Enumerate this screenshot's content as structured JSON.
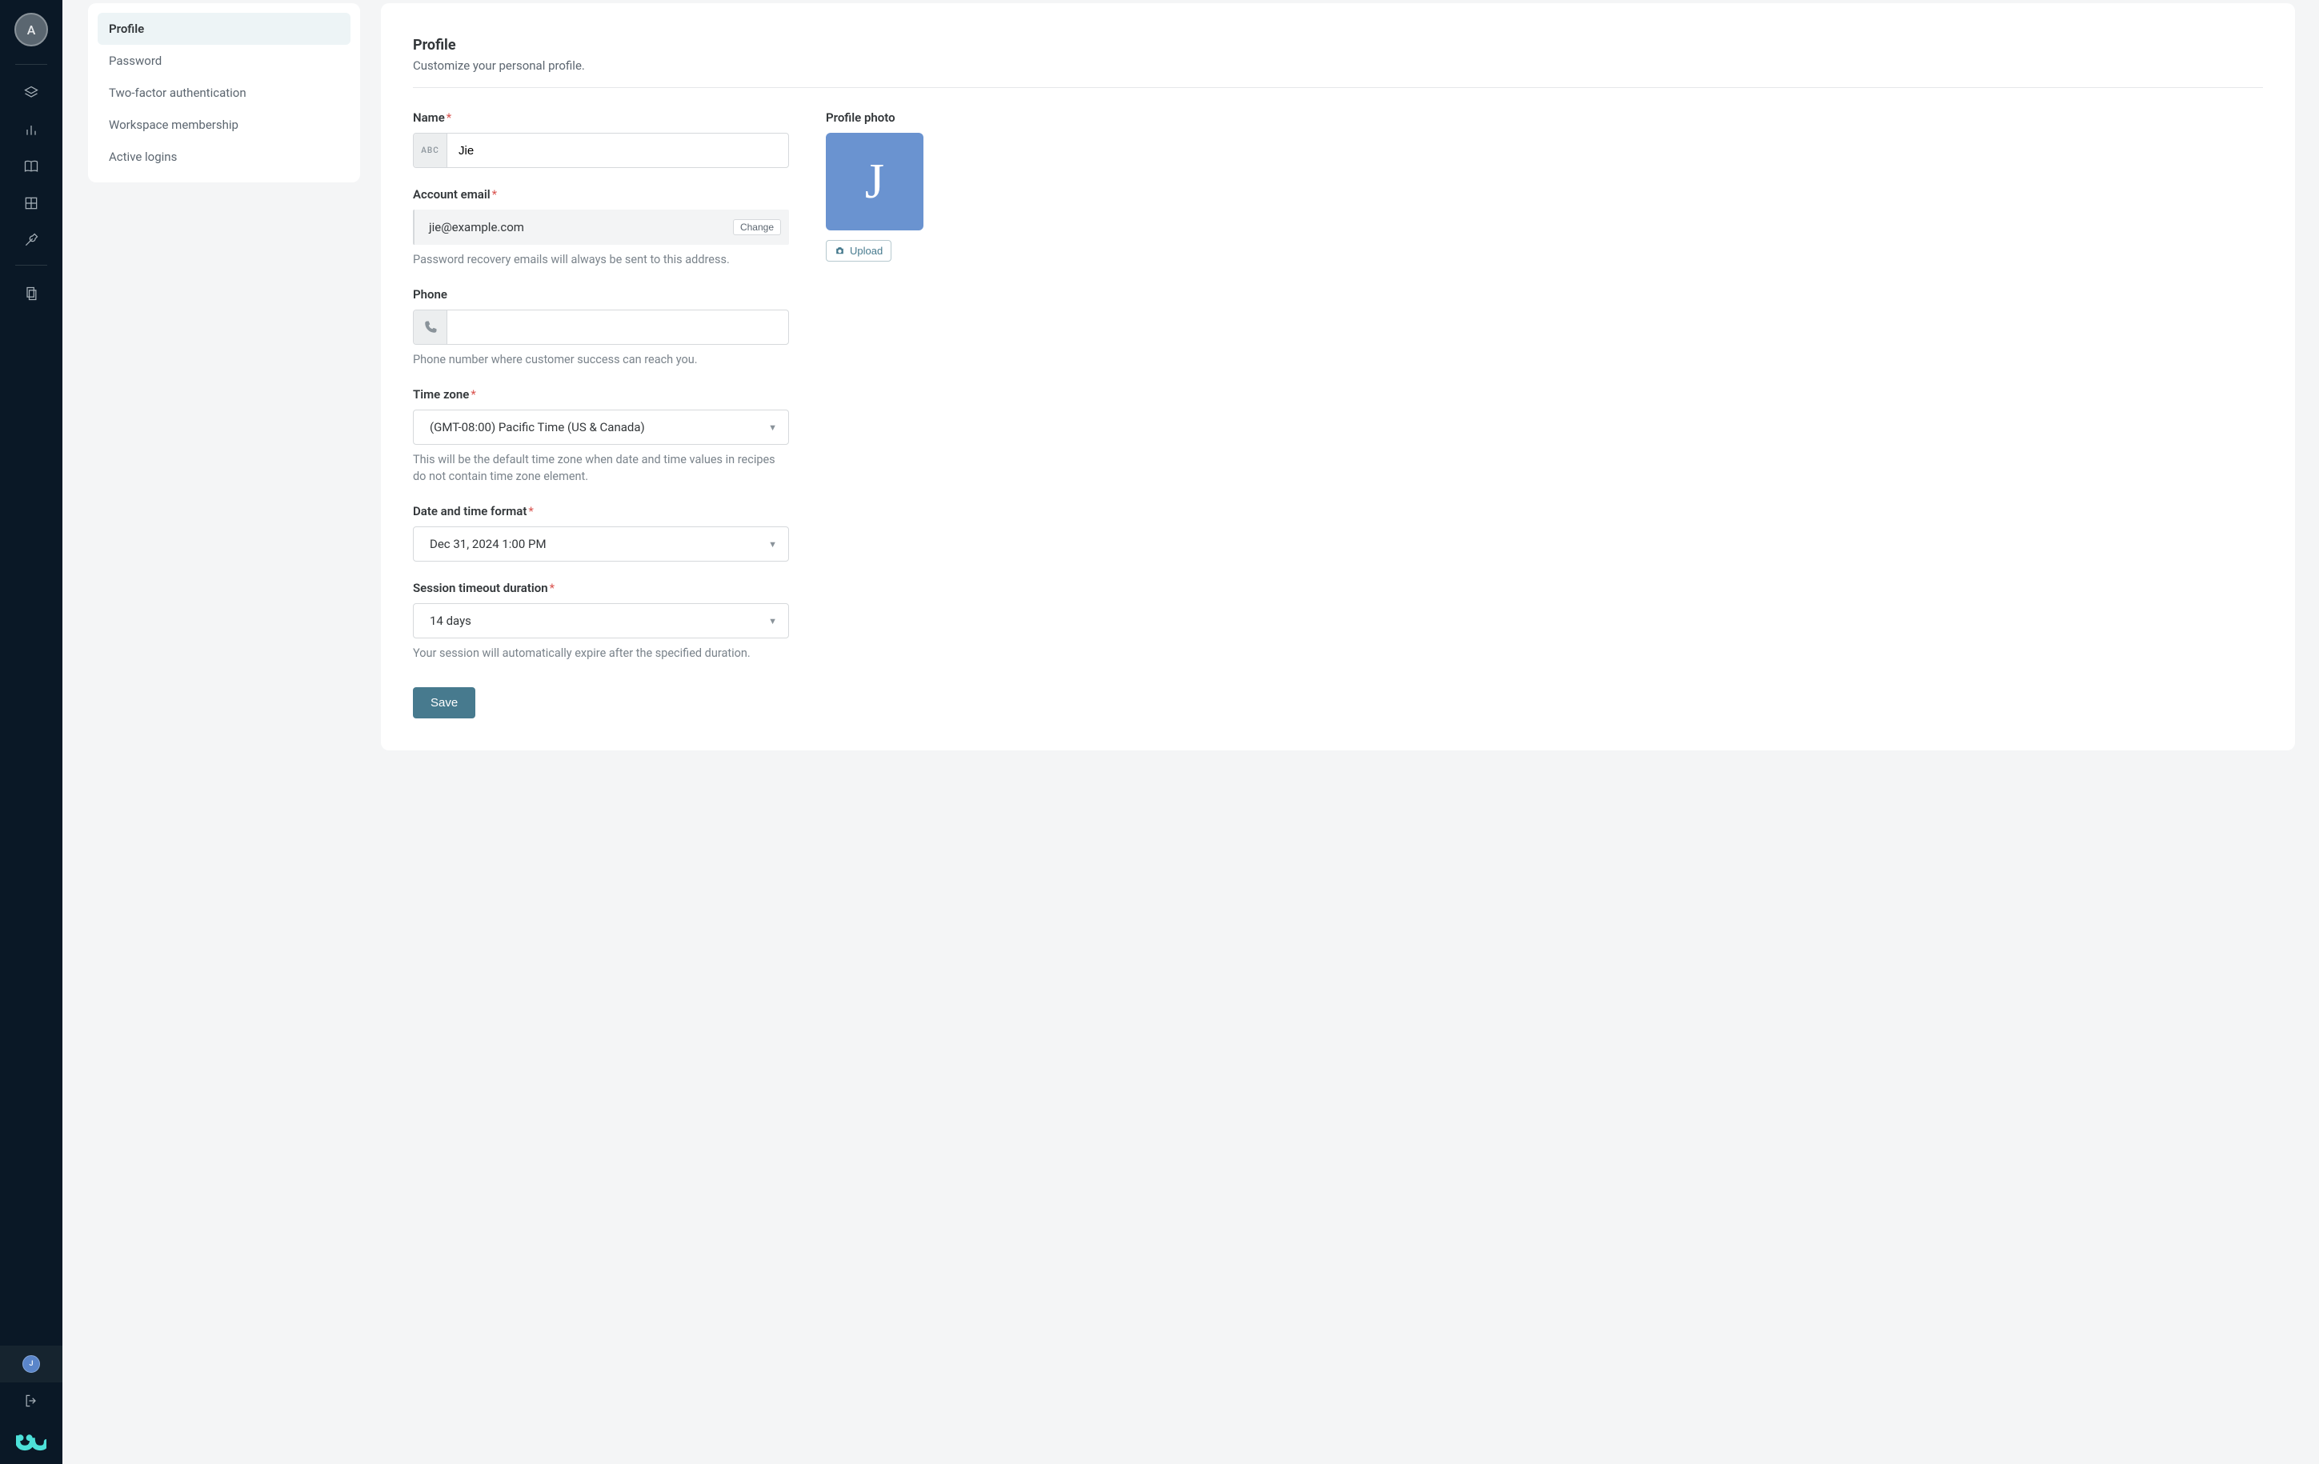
{
  "sidebar": {
    "avatar_letter": "A",
    "user_badge_letter": "J"
  },
  "settings_nav": {
    "items": [
      {
        "label": "Profile",
        "active": true
      },
      {
        "label": "Password"
      },
      {
        "label": "Two-factor authentication"
      },
      {
        "label": "Workspace membership"
      },
      {
        "label": "Active logins"
      }
    ]
  },
  "page": {
    "title": "Profile",
    "subtitle": "Customize your personal profile."
  },
  "form": {
    "name": {
      "label": "Name",
      "prefix": "ABC",
      "value": "Jie"
    },
    "email": {
      "label": "Account email",
      "value": "jie@example.com",
      "change_label": "Change",
      "help": "Password recovery emails will always be sent to this address."
    },
    "phone": {
      "label": "Phone",
      "value": "",
      "help": "Phone number where customer success can reach you."
    },
    "timezone": {
      "label": "Time zone",
      "value": "(GMT-08:00) Pacific Time (US & Canada)",
      "help": "This will be the default time zone when date and time values in recipes do not contain time zone element."
    },
    "datetime": {
      "label": "Date and time format",
      "value": "Dec 31, 2024 1:00 PM"
    },
    "session": {
      "label": "Session timeout duration",
      "value": "14 days",
      "help": "Your session will automatically expire after the specified duration."
    },
    "save_label": "Save"
  },
  "photo": {
    "label": "Profile photo",
    "initial": "J",
    "upload_label": "Upload"
  }
}
